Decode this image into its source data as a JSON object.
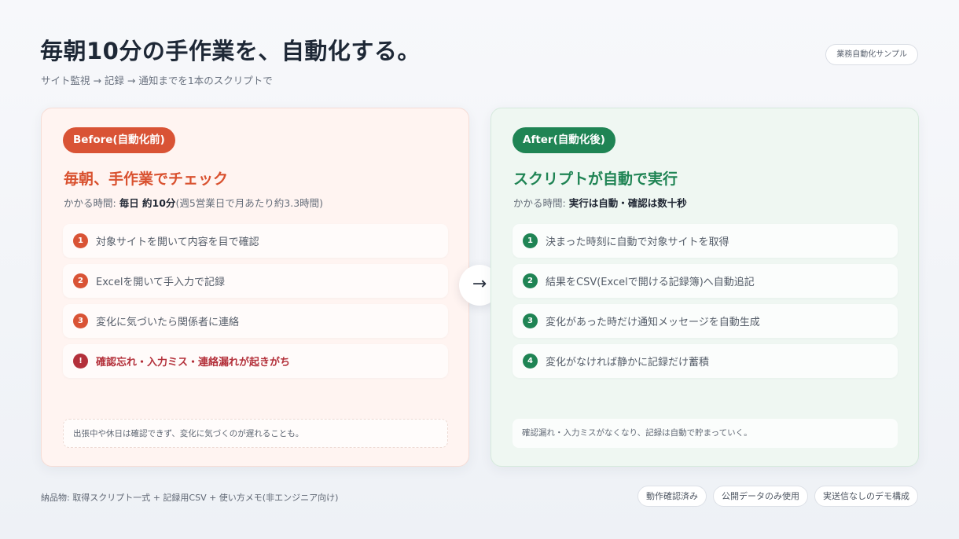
{
  "header": {
    "title": "毎朝10分の手作業を、自動化する。",
    "subtitle": "サイト監視 → 記録 → 通知までを1本のスクリプトで",
    "tag": "業務自動化サンプル"
  },
  "before": {
    "badge": "Before(自動化前)",
    "heading": "毎朝、手作業でチェック",
    "time_label": "かかる時間: ",
    "time_value": "毎日 約10分",
    "time_note": "(週5営業日で月あたり約3.3時間)",
    "steps": [
      {
        "num": "1",
        "text": "対象サイトを開いて内容を目で確認"
      },
      {
        "num": "2",
        "text": "Excelを開いて手入力で記録"
      },
      {
        "num": "3",
        "text": "変化に気づいたら関係者に連絡"
      },
      {
        "num": "!",
        "text": "確認忘れ・入力ミス・連絡漏れが起きがち"
      }
    ],
    "note": "出張中や休日は確認できず、変化に気づくのが遅れることも。"
  },
  "arrow": "→",
  "after": {
    "badge": "After(自動化後)",
    "heading": "スクリプトが自動で実行",
    "time_label": "かかる時間: ",
    "time_value": "実行は自動・確認は数十秒",
    "steps": [
      {
        "num": "1",
        "text": "決まった時刻に自動で対象サイトを取得"
      },
      {
        "num": "2",
        "text": "結果をCSV(Excelで開ける記録簿)へ自動追記"
      },
      {
        "num": "3",
        "text": "変化があった時だけ通知メッセージを自動生成"
      },
      {
        "num": "4",
        "text": "変化がなければ静かに記録だけ蓄積"
      }
    ],
    "note": "確認漏れ・入力ミスがなくなり、記録は自動で貯まっていく。"
  },
  "footer": {
    "deliverables": "納品物: 取得スクリプト一式 + 記録用CSV + 使い方メモ(非エンジニア向け)",
    "tags": [
      "動作確認済み",
      "公開データのみ使用",
      "実送信なしのデモ構成"
    ]
  },
  "colors": {
    "before_accent": "#d95335",
    "after_accent": "#1f8454",
    "warning": "#b3303a"
  }
}
